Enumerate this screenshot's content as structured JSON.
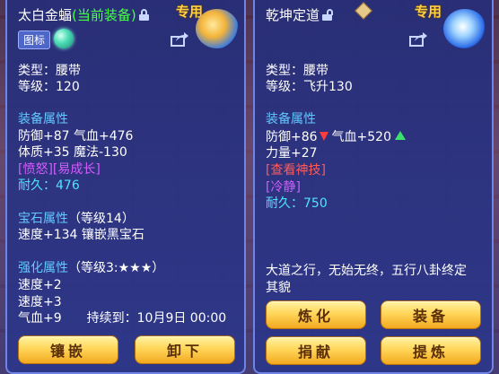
{
  "left": {
    "name": "太白金蝠",
    "status": "(当前装备)",
    "exclusive": "专用",
    "icon_chip": "图标",
    "type_line": "类型：腰带",
    "level_line": "等级：120",
    "equip_attr_title": "装备属性",
    "attr1": "防御+87 气血+476",
    "attr2": "体质+35 魔法-130",
    "special": "[愤怒][易成长]",
    "durability": "耐久：476",
    "gem_title": "宝石属性",
    "gem_level": "（等级14）",
    "gem_effect": "速度+134 镶嵌黑宝石",
    "enhance_title": "强化属性",
    "enhance_level": "（等级3:★★★）",
    "enh1": "速度+2",
    "enh2": "速度+3",
    "enh3_stat": "气血+9",
    "enh3_duration": "持续到：10月9日 00:00",
    "buttons": [
      "镶嵌",
      "卸下"
    ]
  },
  "right": {
    "name": "乾坤定道",
    "exclusive": "专用",
    "type_line": "类型：腰带",
    "level_line": "等级：飞升130",
    "equip_attr_title": "装备属性",
    "def": "防御+86",
    "hp": "气血+520",
    "strength": "力量+27",
    "skill_link": "[查看神技]",
    "special": "[冷静]",
    "durability": "耐久：750",
    "description": [
      "大道之行，无始无终，五行八卦终定",
      "其貌"
    ],
    "buttons": [
      "炼化",
      "装备",
      "捐献",
      "提炼"
    ]
  },
  "colors": {
    "panel": "#2c368a",
    "section_blue": "#63c8ff",
    "special_purple": "#d65cff",
    "durability_cyan": "#4fe3ff",
    "link_red": "#ff5b5b",
    "exclusive_gold": "#ffd13d",
    "status_green": "#48ff4a"
  },
  "icons": [
    "lock-icon",
    "unlock-icon",
    "share-icon",
    "pearl-icon",
    "diamond-icon",
    "arrow-down-icon",
    "arrow-up-icon"
  ]
}
